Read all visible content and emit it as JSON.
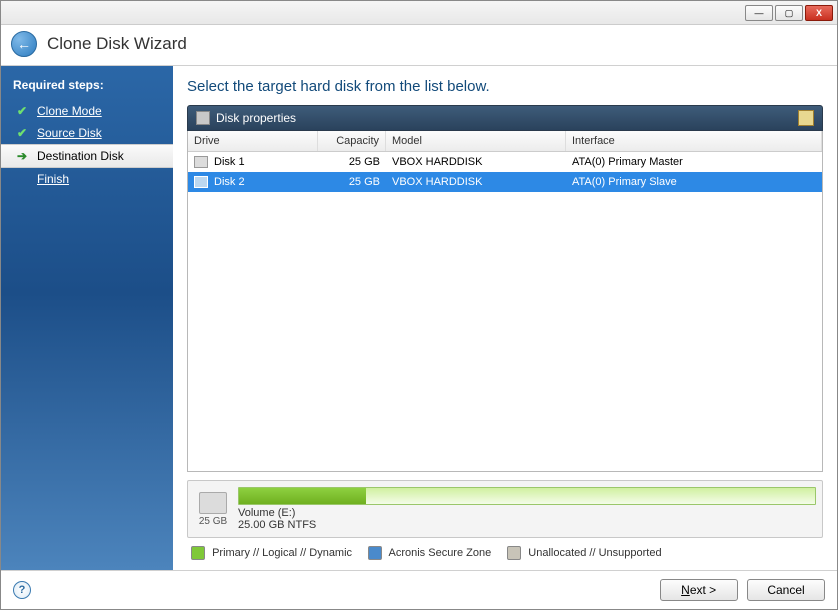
{
  "title": "Clone Disk Wizard",
  "sidebar": {
    "heading": "Required steps:",
    "steps": [
      {
        "label": "Clone Mode",
        "done": true
      },
      {
        "label": "Source Disk",
        "done": true
      },
      {
        "label": "Destination Disk",
        "active": true
      },
      {
        "label": "Finish",
        "pending": true
      }
    ]
  },
  "main": {
    "heading": "Select the target hard disk from the list below.",
    "panel_title": "Disk properties",
    "columns": {
      "drive": "Drive",
      "capacity": "Capacity",
      "model": "Model",
      "interface": "Interface"
    },
    "rows": [
      {
        "drive": "Disk 1",
        "capacity": "25 GB",
        "model": "VBOX HARDDISK",
        "interface": "ATA(0) Primary Master",
        "selected": false
      },
      {
        "drive": "Disk 2",
        "capacity": "25 GB",
        "model": "VBOX HARDDISK",
        "interface": "ATA(0) Primary Slave",
        "selected": true
      }
    ],
    "summary": {
      "size_label": "25 GB",
      "volume_name": "Volume (E:)",
      "volume_detail": "25.00 GB   NTFS"
    },
    "legend": {
      "primary": "Primary // Logical // Dynamic",
      "asz": "Acronis Secure Zone",
      "unalloc": "Unallocated // Unsupported"
    },
    "colors": {
      "primary": "#7fc838",
      "asz": "#4a8acb",
      "unalloc": "#c8c4b8"
    }
  },
  "footer": {
    "next": "Next >",
    "cancel": "Cancel"
  }
}
